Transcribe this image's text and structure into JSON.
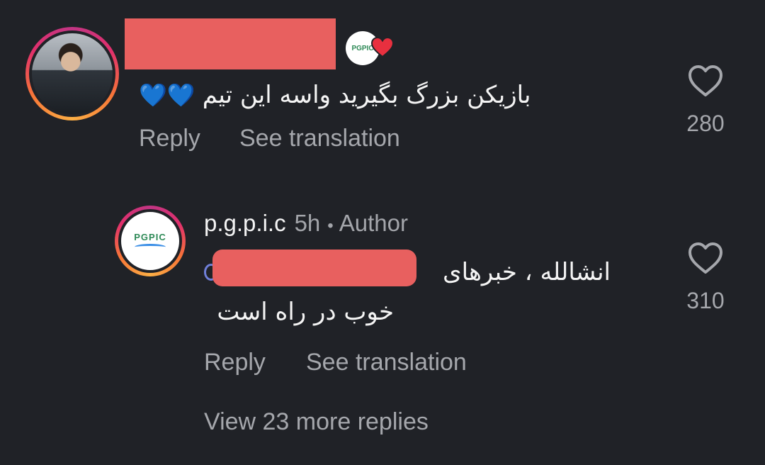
{
  "comments": [
    {
      "username": "",
      "verified_badge_text": "PGPIC",
      "text": "بازیکن بزرگ بگیرید واسه این تیم",
      "emoji": "💙💙",
      "like_count": "280",
      "actions": {
        "reply": "Reply",
        "translate": "See translation"
      }
    },
    {
      "username": "p.g.p.i.c",
      "time": "5h",
      "dot": "•",
      "author_badge": "Author",
      "avatar_logo_text": "PGPIC",
      "text_line1": "انشالله ، خبرهای",
      "text_line2": "خوب در راه است",
      "like_count": "310",
      "actions": {
        "reply": "Reply",
        "translate": "See translation"
      }
    }
  ],
  "view_more": "View 23 more replies",
  "colors": {
    "background": "#202227",
    "primary_text": "#f4f4f4",
    "secondary_text": "#a5a7ac",
    "redaction": "#e8605f"
  }
}
